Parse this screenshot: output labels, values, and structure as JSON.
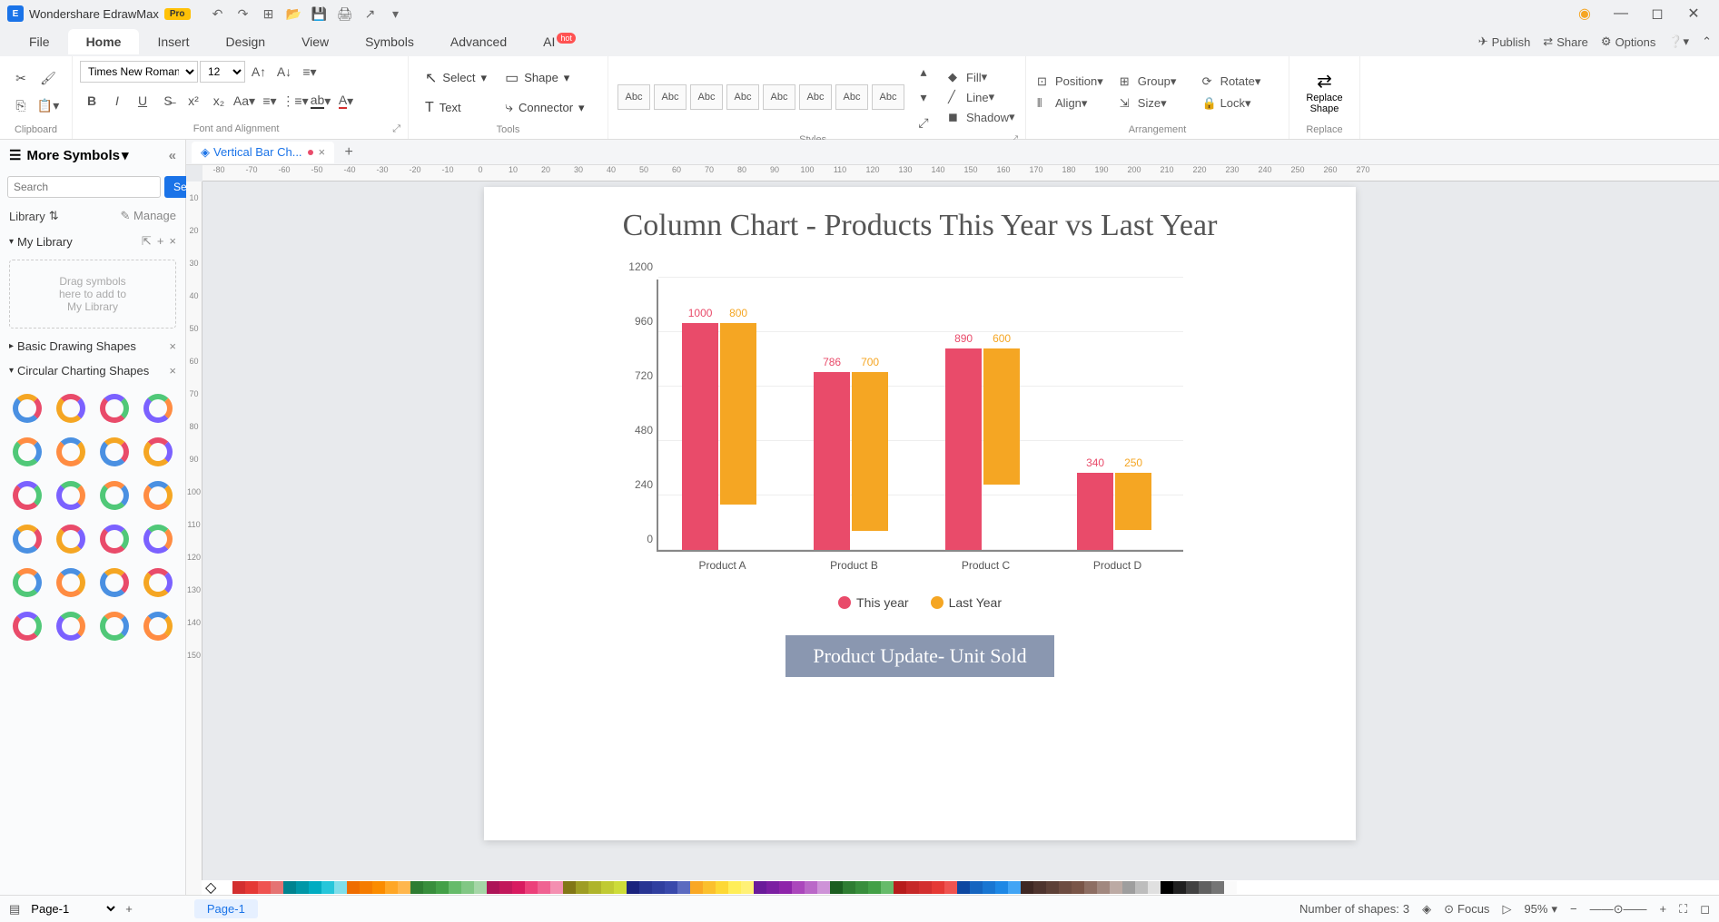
{
  "app": {
    "title": "Wondershare EdrawMax",
    "badge": "Pro"
  },
  "menu": {
    "items": [
      "File",
      "Home",
      "Insert",
      "Design",
      "View",
      "Symbols",
      "Advanced",
      "AI"
    ],
    "active": "Home",
    "right": {
      "publish": "Publish",
      "share": "Share",
      "options": "Options"
    },
    "hot": "hot"
  },
  "ribbon": {
    "font": "Times New Roman",
    "size": "12",
    "groups": {
      "clipboard": "Clipboard",
      "font": "Font and Alignment",
      "tools": "Tools",
      "styles": "Styles",
      "arrangement": "Arrangement",
      "replace": "Replace"
    },
    "tools": {
      "select": "Select",
      "shape": "Shape",
      "text": "Text",
      "connector": "Connector"
    },
    "style_label": "Abc",
    "fill": "Fill",
    "line": "Line",
    "shadow": "Shadow",
    "position": "Position",
    "group": "Group",
    "rotate": "Rotate",
    "align": "Align",
    "size_l": "Size",
    "lock": "Lock",
    "replace_shape": "Replace\nShape"
  },
  "sidebar": {
    "title": "More Symbols",
    "search_placeholder": "Search",
    "search_btn": "Search",
    "library": "Library",
    "manage": "Manage",
    "my_library": "My Library",
    "dropzone": "Drag symbols\nhere to add to\nMy Library",
    "basic": "Basic Drawing Shapes",
    "circular": "Circular Charting Shapes"
  },
  "doc_tab": "Vertical Bar Ch...",
  "ruler_h": [
    "-80",
    "-70",
    "-60",
    "-50",
    "-40",
    "-30",
    "-20",
    "-10",
    "0",
    "10",
    "20",
    "30",
    "40",
    "50",
    "60",
    "70",
    "80",
    "90",
    "100",
    "110",
    "120",
    "130",
    "140",
    "150",
    "160",
    "170",
    "180",
    "190",
    "200",
    "210",
    "220",
    "230",
    "240",
    "250",
    "260",
    "270"
  ],
  "ruler_v": [
    "10",
    "20",
    "30",
    "40",
    "50",
    "60",
    "70",
    "80",
    "90",
    "100",
    "110",
    "120",
    "130",
    "140",
    "150"
  ],
  "chart_data": {
    "type": "bar",
    "title": "Column Chart - Products This Year vs Last Year",
    "subtitle": "Product Update- Unit Sold",
    "categories": [
      "Product A",
      "Product B",
      "Product C",
      "Product D"
    ],
    "series": [
      {
        "name": "This year",
        "color": "#e94b6a",
        "values": [
          1000,
          786,
          890,
          340
        ]
      },
      {
        "name": "Last Year",
        "color": "#f5a623",
        "values": [
          800,
          700,
          600,
          250
        ]
      }
    ],
    "y_ticks": [
      0,
      240,
      480,
      720,
      960,
      1200
    ],
    "ylim": [
      0,
      1200
    ]
  },
  "colors": [
    "#ffffff",
    "#d32f2f",
    "#e53935",
    "#ef5350",
    "#e57373",
    "#00838f",
    "#0097a7",
    "#00acc1",
    "#26c6da",
    "#80deea",
    "#ef6c00",
    "#f57c00",
    "#fb8c00",
    "#ffa726",
    "#ffb74d",
    "#2e7d32",
    "#388e3c",
    "#43a047",
    "#66bb6a",
    "#81c784",
    "#a5d6a7",
    "#ad1457",
    "#c2185b",
    "#d81b60",
    "#ec407a",
    "#f06292",
    "#f48fb1",
    "#827717",
    "#9e9d24",
    "#afb42b",
    "#c0ca33",
    "#cddc39",
    "#1a237e",
    "#283593",
    "#303f9f",
    "#3949ab",
    "#5c6bc0",
    "#f9a825",
    "#fbc02d",
    "#fdd835",
    "#ffee58",
    "#fff176",
    "#6a1b9a",
    "#7b1fa2",
    "#8e24aa",
    "#ab47bc",
    "#ba68c8",
    "#ce93d8",
    "#1b5e20",
    "#2e7d32",
    "#388e3c",
    "#43a047",
    "#66bb6a",
    "#b71c1c",
    "#c62828",
    "#d32f2f",
    "#e53935",
    "#ef5350",
    "#0d47a1",
    "#1565c0",
    "#1976d2",
    "#1e88e5",
    "#42a5f5",
    "#3e2723",
    "#4e342e",
    "#5d4037",
    "#6d4c41",
    "#795548",
    "#8d6e63",
    "#a1887f",
    "#bcaaa4",
    "#9e9e9e",
    "#bdbdbd",
    "#e0e0e0",
    "#000000",
    "#212121",
    "#424242",
    "#616161",
    "#757575",
    "#fafafa"
  ],
  "status": {
    "page": "Page-1",
    "page_tab": "Page-1",
    "shapes_label": "Number of shapes:",
    "shapes": "3",
    "focus": "Focus",
    "zoom": "95%"
  }
}
